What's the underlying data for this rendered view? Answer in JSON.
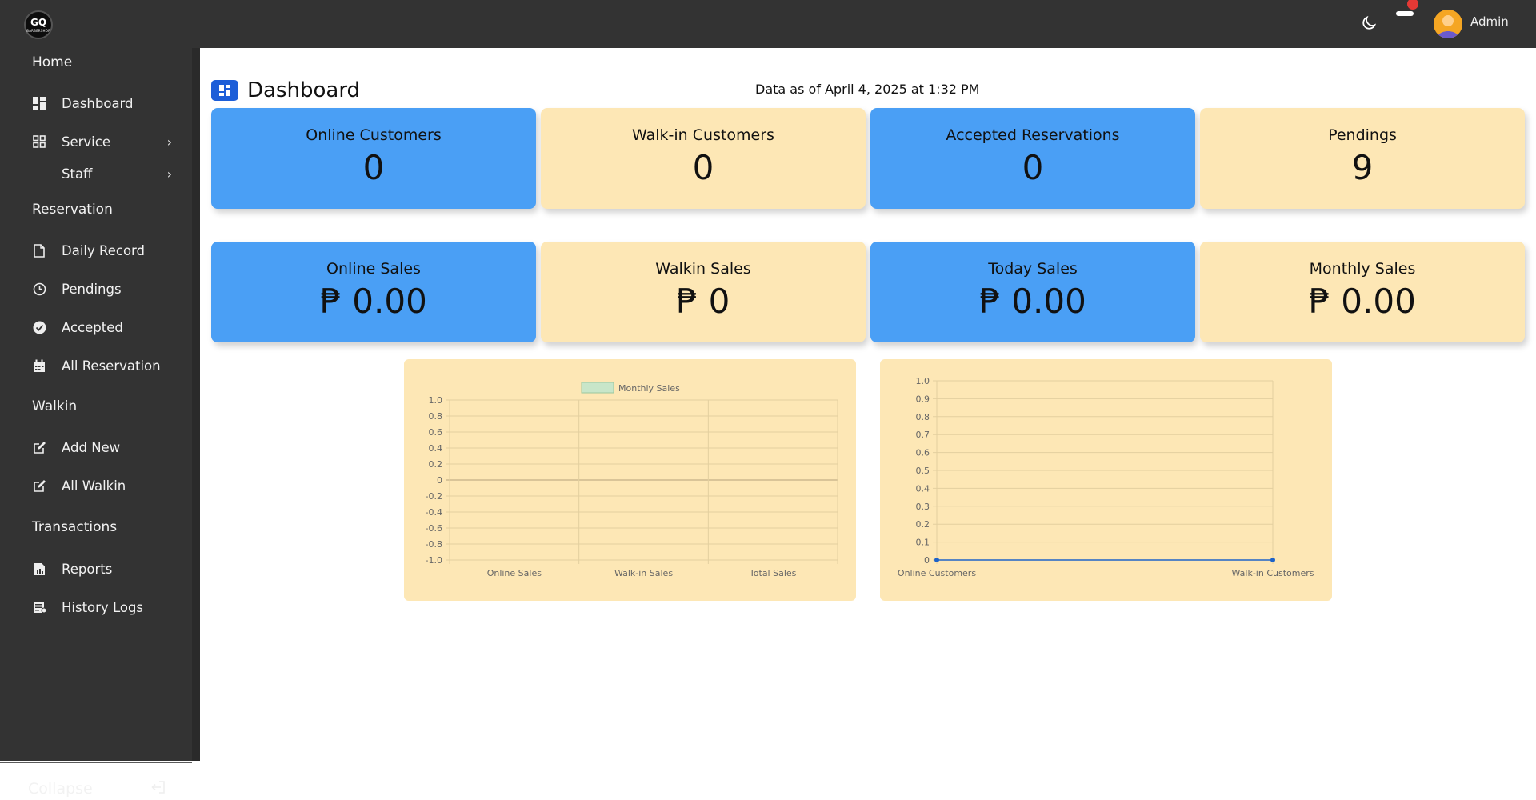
{
  "header": {
    "logo_text": "GQ",
    "logo_subtext": "BARBERSHOP",
    "user_name": "Admin",
    "theme_toggle_icon": "moon-icon",
    "notification_icon": "bell-icon"
  },
  "sidebar": {
    "sections": [
      {
        "title": "Home"
      },
      {
        "title": "Reservation"
      },
      {
        "title": "Walkin"
      },
      {
        "title": "Transactions"
      }
    ],
    "items": [
      {
        "label": "Dashboard",
        "icon": "dashboard-icon"
      },
      {
        "label": "Service",
        "icon": "grid-icon"
      },
      {
        "label": "Staff"
      },
      {
        "label": "Daily Record",
        "icon": "file-icon"
      },
      {
        "label": "Pendings",
        "icon": "clock-icon"
      },
      {
        "label": "Accepted",
        "icon": "check-badge-icon"
      },
      {
        "label": "All Reservation",
        "icon": "calendar-icon"
      },
      {
        "label": "Add New",
        "icon": "edit-icon"
      },
      {
        "label": "All Walkin",
        "icon": "edit-icon"
      },
      {
        "label": "Reports",
        "icon": "report-icon"
      },
      {
        "label": "History Logs",
        "icon": "history-icon"
      }
    ],
    "collapse_label": "Collapse"
  },
  "main": {
    "title": "Dashboard",
    "timestamp": "Data as of April 4, 2025 at 1:32 PM",
    "stat_cards": [
      {
        "label": "Online Customers",
        "value": "0",
        "color": "#4a9ff5"
      },
      {
        "label": "Walk-in Customers",
        "value": "0",
        "color": "#fde7b5"
      },
      {
        "label": "Accepted Reservations",
        "value": "0",
        "color": "#4a9ff5"
      },
      {
        "label": "Pendings",
        "value": "9",
        "color": "#fde7b5"
      }
    ],
    "sales_cards": [
      {
        "label": "Online Sales",
        "value": "₱ 0.00",
        "color": "#4a9ff5"
      },
      {
        "label": "Walkin Sales",
        "value": "₱ 0",
        "color": "#fde7b5"
      },
      {
        "label": "Today Sales",
        "value": "₱ 0.00",
        "color": "#4a9ff5"
      },
      {
        "label": "Monthly Sales",
        "value": "₱ 0.00",
        "color": "#fde7b5"
      }
    ]
  },
  "chart_data": [
    {
      "type": "bar",
      "categories": [
        "Online Sales",
        "Walk-in Sales",
        "Total Sales"
      ],
      "series": [
        {
          "name": "Monthly Sales",
          "values": [
            0,
            0,
            0
          ],
          "color": "#c8e6c9"
        }
      ],
      "ylim": [
        -1.0,
        1.0
      ],
      "yticks": [
        "1.0",
        "0.8",
        "0.6",
        "0.4",
        "0.2",
        "0",
        "-0.2",
        "-0.4",
        "-0.6",
        "-0.8",
        "-1.0"
      ],
      "legend": "top-center",
      "grid": true
    },
    {
      "type": "line",
      "categories": [
        "Online Customers",
        "Walk-in Customers"
      ],
      "series": [
        {
          "values": [
            0,
            0
          ],
          "color": "#1e63c8"
        }
      ],
      "ylim": [
        0,
        1.0
      ],
      "yticks": [
        "1.0",
        "0.9",
        "0.8",
        "0.7",
        "0.6",
        "0.5",
        "0.4",
        "0.3",
        "0.2",
        "0.1",
        "0"
      ],
      "grid": true
    }
  ]
}
